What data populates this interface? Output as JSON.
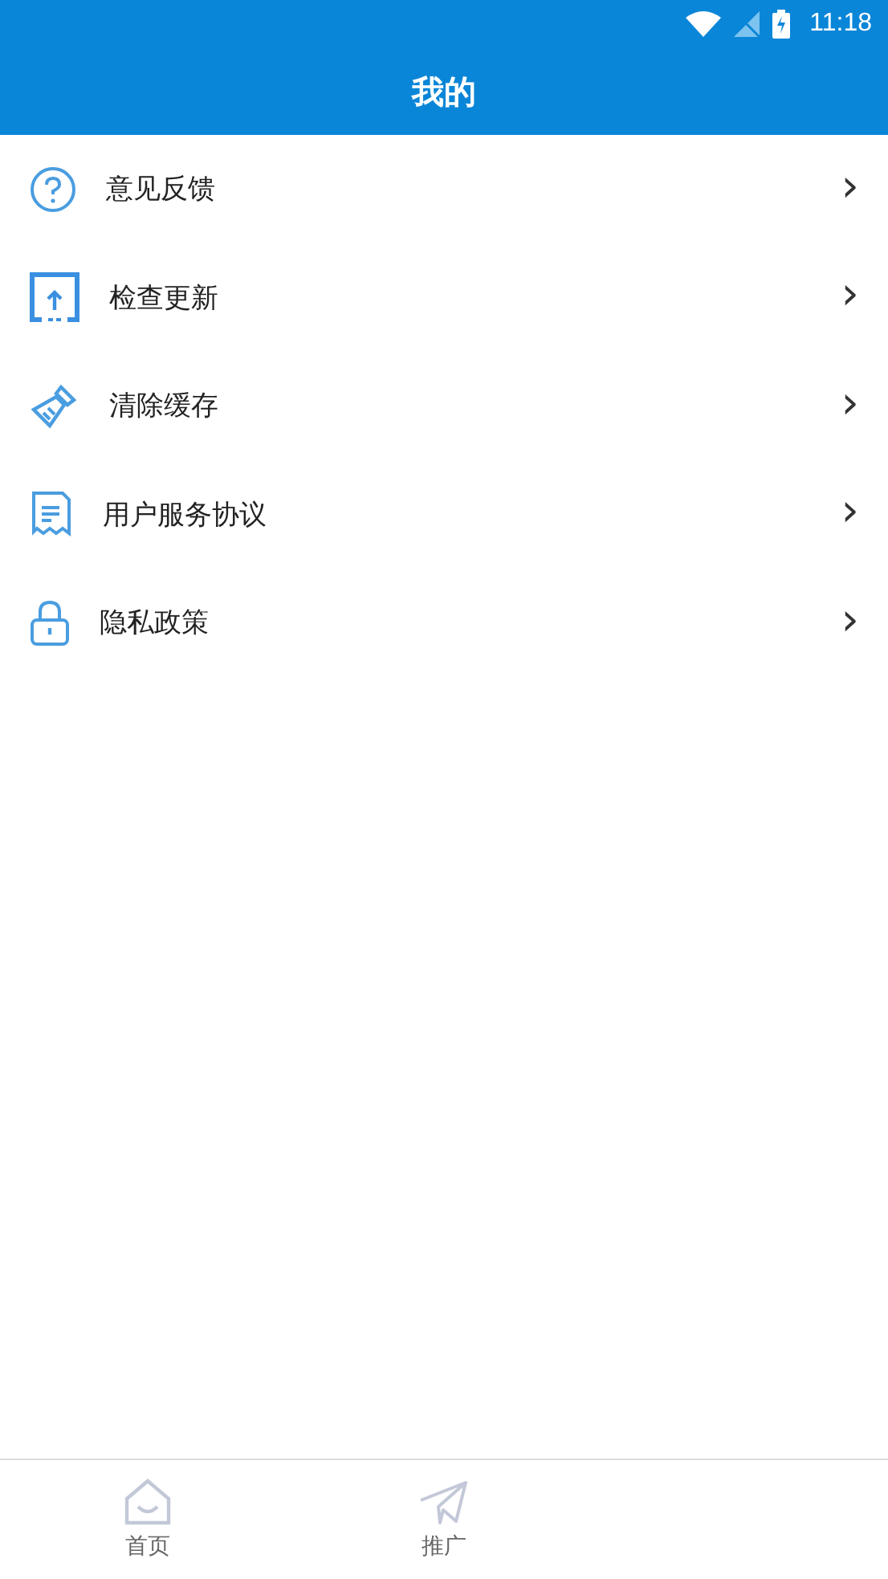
{
  "status_bar": {
    "time": "11:18"
  },
  "header": {
    "title": "我的"
  },
  "menu": [
    {
      "label": "意见反馈",
      "chevron": "›"
    },
    {
      "label": "检查更新",
      "chevron": "›"
    },
    {
      "label": "清除缓存",
      "chevron": "›"
    },
    {
      "label": "用户服务协议",
      "chevron": "›"
    },
    {
      "label": "隐私政策",
      "chevron": "›"
    }
  ],
  "tabs": [
    {
      "label": "首页",
      "selected": false
    },
    {
      "label": "推广",
      "selected": false
    }
  ]
}
